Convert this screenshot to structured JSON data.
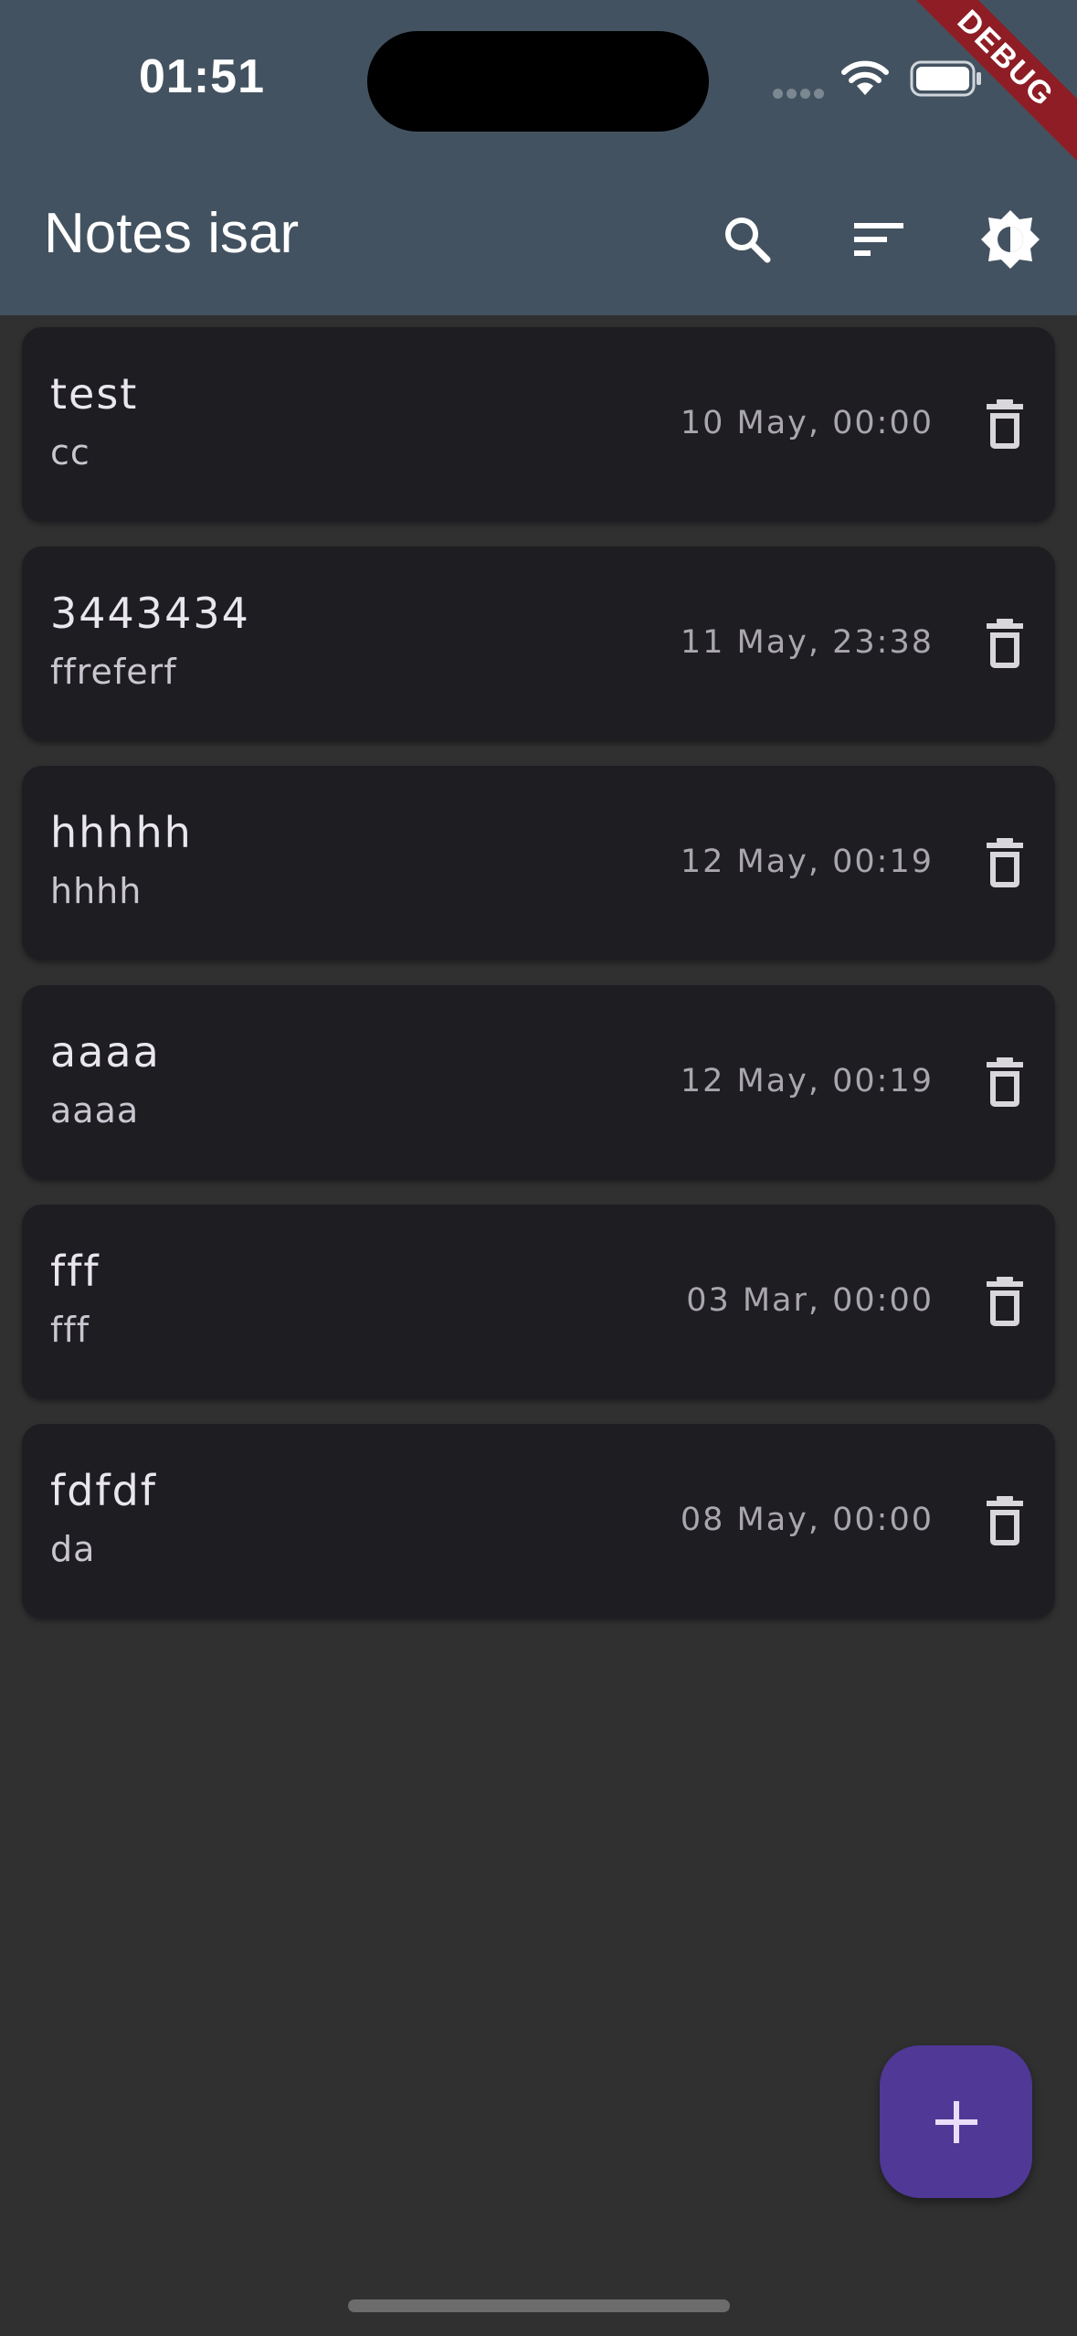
{
  "status_bar": {
    "time": "01:51",
    "debug_label": "DEBUG"
  },
  "app_bar": {
    "title": "Notes isar",
    "actions": [
      "search-icon",
      "sort-icon",
      "brightness-icon"
    ]
  },
  "notes": [
    {
      "title": "test",
      "subtitle": "cc",
      "date": "10 May, 00:00"
    },
    {
      "title": "3443434",
      "subtitle": "ffreferf",
      "date": "11 May, 23:38"
    },
    {
      "title": "hhhhh",
      "subtitle": "hhhh",
      "date": "12 May, 00:19"
    },
    {
      "title": "aaaa",
      "subtitle": "aaaa",
      "date": "12 May, 00:19"
    },
    {
      "title": "fff",
      "subtitle": "fff",
      "date": "03 Mar, 00:00"
    },
    {
      "title": "fdfdf",
      "subtitle": "da",
      "date": "08 May, 00:00"
    }
  ],
  "colors": {
    "app_bar": "#435260",
    "background": "#303030",
    "card": "#1e1d22",
    "fab": "#4f3896",
    "debug_banner": "#8e1d25"
  },
  "fab_icon": "add-icon"
}
